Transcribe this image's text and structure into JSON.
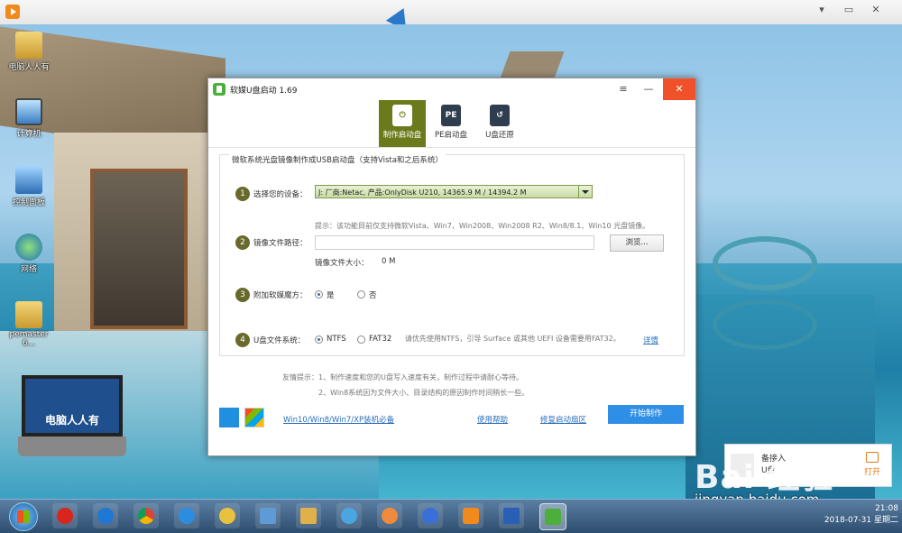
{
  "viewer": {
    "controls": [
      "▾",
      "▭",
      "✕"
    ]
  },
  "desktop": {
    "icons": [
      {
        "label": "电脑人人有"
      },
      {
        "label": "计算机"
      },
      {
        "label": "控制面板"
      },
      {
        "label": "网络"
      },
      {
        "label": "pemaster 6..."
      }
    ],
    "brand_board_text": "电脑人人有"
  },
  "app": {
    "title": "软媒U盘启动 1.69",
    "title_controls": {
      "menu": "≡",
      "minimize": "—",
      "close": "✕"
    },
    "tabs": [
      {
        "label": "制作启动盘",
        "icon": "usb-power-icon",
        "active": true
      },
      {
        "label": "PE启动盘",
        "icon": "pe-usb-icon",
        "badge": "PE"
      },
      {
        "label": "U盘还原",
        "icon": "usb-restore-icon"
      }
    ],
    "panel_title": "微软系统光盘镜像制作成USB启动盘（支持Vista和之后系统）",
    "steps": [
      {
        "num": "1",
        "label": "选择您的设备："
      },
      {
        "num": "2",
        "label": "镜像文件路径："
      },
      {
        "num": "3",
        "label": "附加软媒魔方："
      },
      {
        "num": "4",
        "label": "U盘文件系统："
      }
    ],
    "device_selected": "J: 厂商:Netac, 产品:OnlyDisk U210,  14365.9 M / 14394.2 M",
    "hint": "提示：该功能目前仅支持微软Vista、Win7、Win2008、Win2008 R2、Win8/8.1、Win10 光盘镜像。",
    "image_path_value": "",
    "browse_label": "浏览...",
    "image_size_label": "镜像文件大小：",
    "image_size_value": "0 M",
    "magic_options": {
      "yes": "是",
      "no": "否",
      "selected": "yes"
    },
    "fs_options": {
      "ntfs": "NTFS",
      "fat32": "FAT32",
      "selected": "ntfs"
    },
    "fs_hint": "请优先使用NTFS，引导 Surface 或其他 UEFI 设备需要用FAT32。",
    "details_link": "详情",
    "tips": [
      "友情提示：1、制作速度和您的U盘写入速度有关，制作过程中请耐心等待。",
      "　　　　　2、Win8系统因为文件大小、目录结构的原因制作时间稍长一些。"
    ],
    "footer_link_1": "Win10/Win8/Win7/XP装机必备",
    "footer_link_2": "使用帮助",
    "footer_link_3": "修复启动扇区",
    "start_button": "开始制作"
  },
  "toast": {
    "line1": "备接入",
    "line2": "U盘",
    "open_label": "打开"
  },
  "taskbar": {
    "clock_time": "21:08",
    "clock_date": "2018-07-31 星期二",
    "active_app": "软媒U盘启动"
  },
  "watermark": {
    "logo": "Bai 经验",
    "url": "jingyan.baidu.com"
  },
  "colors": {
    "accent_tab": "#6b7b1c",
    "step_circle": "#676a2a",
    "primary_button": "#2f8ee6",
    "close_button": "#f0512a",
    "link": "#2a6ebb"
  }
}
